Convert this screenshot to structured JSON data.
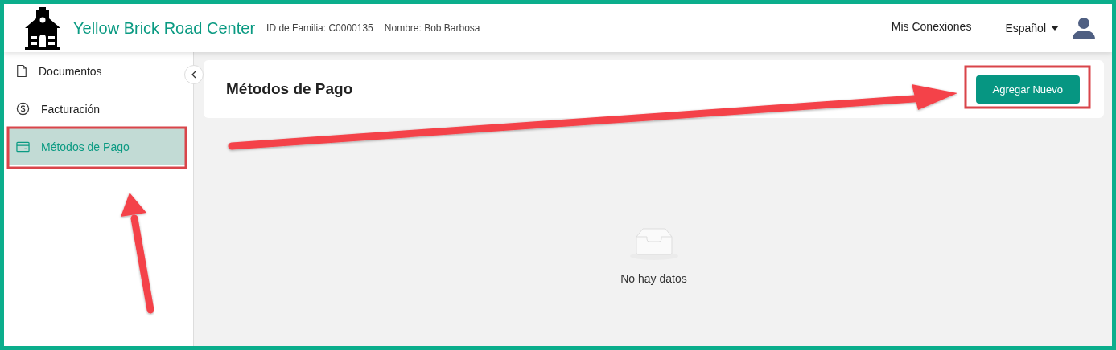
{
  "header": {
    "brand": "Yellow Brick Road Center",
    "family_id": "ID de Familia: C0000135",
    "name": "Nombre: Bob Barbosa",
    "links": [
      "Mis Conexiones"
    ],
    "language": "Español"
  },
  "sidebar": {
    "items": [
      {
        "label": "Documentos",
        "selected": false
      },
      {
        "label": "Facturación",
        "selected": false
      },
      {
        "label": "Métodos de Pago",
        "selected": true
      }
    ]
  },
  "page": {
    "title": "Métodos de Pago",
    "button": "Agregar Nuevo",
    "empty_text": "No hay datos"
  }
}
